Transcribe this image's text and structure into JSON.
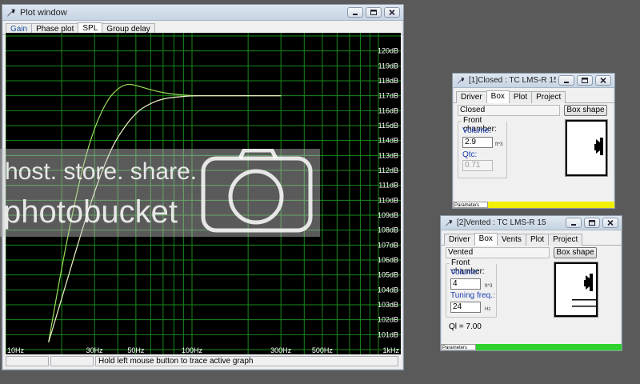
{
  "plot_window": {
    "title": "Plot window",
    "tabs": [
      {
        "label": "Gain",
        "active": false
      },
      {
        "label": "Phase plot",
        "active": false
      },
      {
        "label": "SPL",
        "active": true
      },
      {
        "label": "Group delay",
        "active": false
      }
    ],
    "status_text": "Hold left mouse button to trace active graph"
  },
  "chart_data": {
    "type": "line",
    "x_scale": "log",
    "xlim": [
      10,
      1000
    ],
    "ylim": [
      100,
      121
    ],
    "x_ticks": [
      {
        "value": 10,
        "label": "10Hz"
      },
      {
        "value": 30,
        "label": "30Hz"
      },
      {
        "value": 50,
        "label": "50Hz"
      },
      {
        "value": 100,
        "label": "100Hz"
      },
      {
        "value": 300,
        "label": "300Hz"
      },
      {
        "value": 500,
        "label": "500Hz"
      },
      {
        "value": 1000,
        "label": "1kHz"
      }
    ],
    "y_ticks": [
      "101dB",
      "102dB",
      "103dB",
      "104dB",
      "105dB",
      "106dB",
      "107dB",
      "108dB",
      "109dB",
      "110dB",
      "111dB",
      "112dB",
      "113dB",
      "114dB",
      "115dB",
      "116dB",
      "117dB",
      "118dB",
      "119dB",
      "120dB"
    ],
    "grid": true,
    "series": [
      {
        "color": "#9adf5a",
        "x": [
          17,
          20,
          23,
          26,
          30,
          35,
          40,
          45,
          50,
          60,
          70,
          80,
          100,
          120,
          150,
          200,
          300
        ],
        "y": [
          100.5,
          105.5,
          109.3,
          112.3,
          114.9,
          116.7,
          117.5,
          117.8,
          117.7,
          117.4,
          117.2,
          117.1,
          117.0,
          117.0,
          117.0,
          117.0,
          117.0
        ]
      },
      {
        "color": "#f2f2c8",
        "x": [
          17,
          20,
          25,
          30,
          35,
          40,
          50,
          60,
          70,
          80,
          100,
          120,
          150,
          200,
          300
        ],
        "y": [
          100.5,
          103.4,
          107.5,
          110.6,
          112.8,
          114.3,
          115.9,
          116.5,
          116.8,
          116.9,
          117.0,
          117.0,
          117.0,
          117.0,
          117.0
        ]
      }
    ]
  },
  "closed_window": {
    "title": "[1]Closed : TC LMS-R 15",
    "tabs": [
      "Driver",
      "Box",
      "Plot",
      "Project"
    ],
    "active_tab": "Box",
    "box_name": "Closed",
    "box_shape_label": "Box shape",
    "front_chamber_label": "Front chamber:",
    "volume_label": "Volume:",
    "volume_value": "2.9",
    "volume_unit": "ft^3",
    "qtc_label": "Qtc:",
    "qtc_value": "0.71",
    "parameters_label": "Parameters",
    "status_color": "#f0f000"
  },
  "vented_window": {
    "title": "[2]Vented : TC LMS-R 15",
    "tabs": [
      "Driver",
      "Box",
      "Vents",
      "Plot",
      "Project"
    ],
    "active_tab": "Box",
    "box_name": "Vented",
    "box_shape_label": "Box shape",
    "front_chamber_label": "Front chamber:",
    "volume_label": "Volume:",
    "volume_value": "4",
    "volume_unit": "ft^3",
    "tuning_label": "Tuning freq.:",
    "tuning_value": "24",
    "tuning_unit": "Hz",
    "ql_text": "Ql = 7.00",
    "parameters_label": "Parameters",
    "status_color": "#2ed12e"
  },
  "watermark": {
    "line1": "host. store. share.",
    "line2": "photobucket"
  }
}
